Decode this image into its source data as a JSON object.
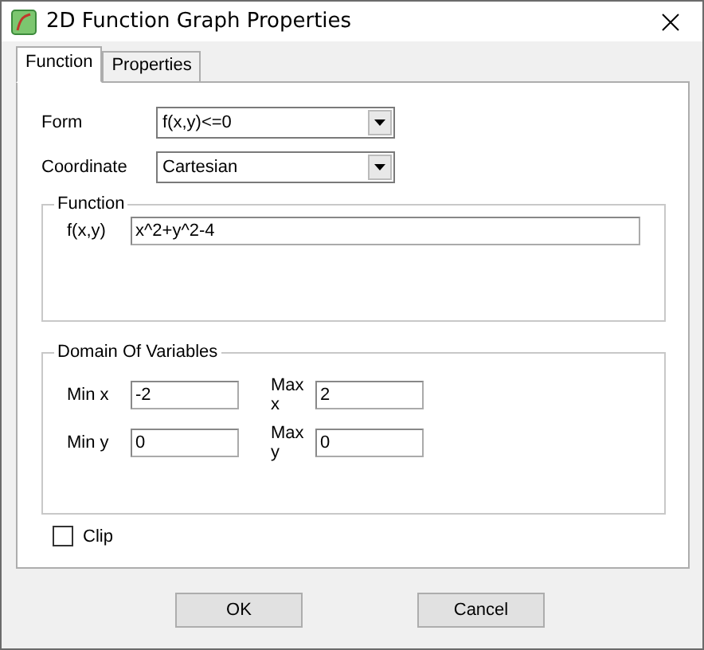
{
  "window": {
    "title": "2D Function Graph Properties"
  },
  "tabs": [
    {
      "label": "Function",
      "selected": true
    },
    {
      "label": "Properties",
      "selected": false
    }
  ],
  "form": {
    "label": "Form",
    "value": "f(x,y)<=0"
  },
  "coordinate": {
    "label": "Coordinate",
    "value": "Cartesian"
  },
  "function_group": {
    "title": "Function",
    "label": "f(x,y)",
    "value": "x^2+y^2-4"
  },
  "domain_group": {
    "title": "Domain Of Variables",
    "fields": [
      {
        "label": "Min x",
        "value": "-2"
      },
      {
        "label": "Max x",
        "value": "2"
      },
      {
        "label": "Min y",
        "value": "0"
      },
      {
        "label": "Max y",
        "value": "0"
      }
    ]
  },
  "clip": {
    "label": "Clip",
    "checked": false
  },
  "buttons": [
    "OK",
    "Cancel"
  ]
}
